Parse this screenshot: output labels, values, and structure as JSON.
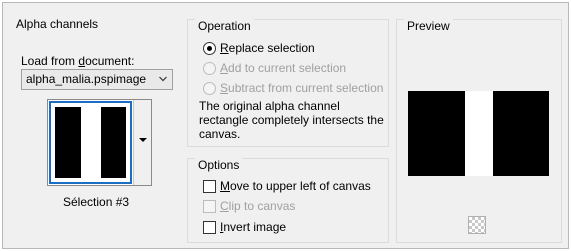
{
  "alpha_channels": {
    "title": "Alpha channels",
    "load_from_label_pre": "Load from ",
    "load_from_label_key": "d",
    "load_from_label_post": "ocument:",
    "document_select_value": "alpha_malia.pspimage",
    "selection_name": "Sélection #3"
  },
  "operation": {
    "title": "Operation",
    "options": [
      {
        "key": "R",
        "rest": "eplace selection",
        "checked": true,
        "disabled": false
      },
      {
        "key": "A",
        "rest": "dd to current selection",
        "checked": false,
        "disabled": true
      },
      {
        "key": "S",
        "rest": "ubtract from current selection",
        "checked": false,
        "disabled": true
      }
    ],
    "description": "The original alpha channel rectangle completely intersects the canvas."
  },
  "options": {
    "title": "Options",
    "checkboxes": [
      {
        "key": "M",
        "rest": "ove to upper left of canvas",
        "checked": false,
        "disabled": false
      },
      {
        "key": "C",
        "rest": "lip to canvas",
        "checked": false,
        "disabled": true
      },
      {
        "key": "I",
        "rest": "nvert image",
        "checked": false,
        "disabled": false
      }
    ]
  },
  "preview": {
    "title": "Preview",
    "pattern": [
      "black",
      "white",
      "black"
    ]
  },
  "colors": {
    "selection_border": "#1a6fc4",
    "disabled_text": "#a0a0a0"
  }
}
